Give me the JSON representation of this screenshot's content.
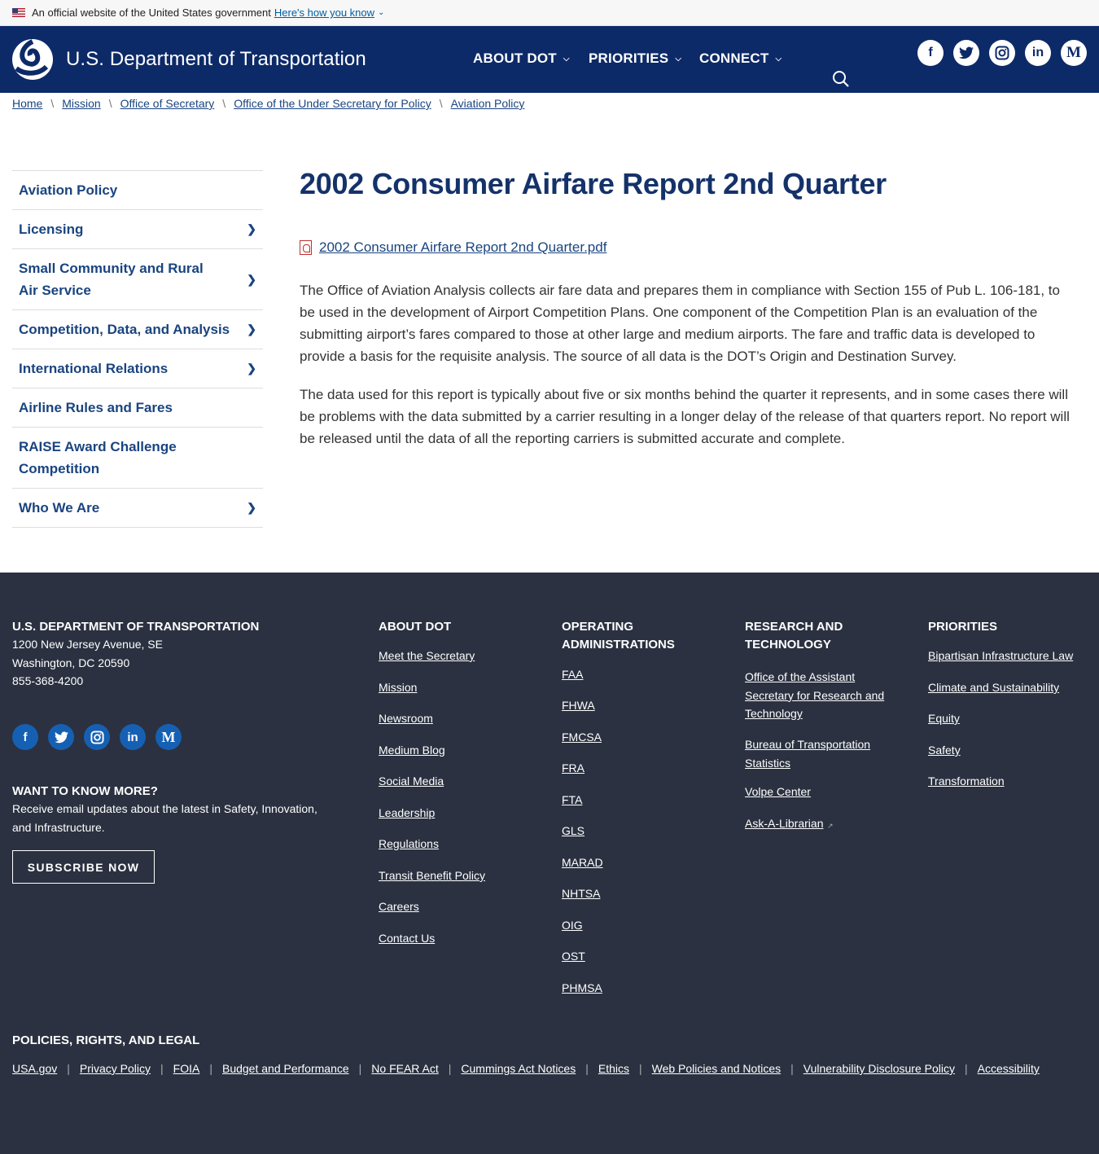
{
  "gov_banner": {
    "text": "An official website of the United States government",
    "link": "Here's how you know"
  },
  "header": {
    "brand": "U.S. Department of Transportation",
    "nav": [
      "ABOUT DOT",
      "PRIORITIES",
      "CONNECT"
    ],
    "social": [
      "facebook-icon",
      "twitter-icon",
      "instagram-icon",
      "linkedin-icon",
      "medium-icon"
    ]
  },
  "breadcrumb": [
    "Home",
    "Mission",
    "Office of Secretary",
    "Office of the Under Secretary for Policy",
    "Aviation Policy"
  ],
  "sidenav": [
    {
      "label": "Aviation Policy",
      "arrow": false
    },
    {
      "label": "Licensing",
      "arrow": true
    },
    {
      "label": "Small Community and Rural Air Service",
      "arrow": true
    },
    {
      "label": "Competition, Data, and Analysis",
      "arrow": true
    },
    {
      "label": "International Relations",
      "arrow": true
    },
    {
      "label": "Airline Rules and Fares",
      "arrow": false
    },
    {
      "label": "RAISE Award Challenge Competition",
      "arrow": false
    },
    {
      "label": "Who We Are",
      "arrow": true
    }
  ],
  "main": {
    "title": "2002 Consumer Airfare Report 2nd Quarter",
    "file": "2002 Consumer Airfare Report 2nd Quarter.pdf",
    "para1": "The Office of Aviation Analysis collects air fare data and prepares them in compliance with Section 155 of Pub L. 106-181, to be used in the development of Airport Competition Plans. One component of the Competition Plan is an evaluation of the submitting airport’s fares compared to those at other large and medium airports. The fare and traffic data is developed to provide a basis for the requisite analysis. The source of all data is the DOT’s Origin and Destination Survey.",
    "para2": "The data used for this report is typically about five or six months behind the quarter it represents, and in some cases there will be problems with the data submitted by a carrier resulting in a longer delay of the release of that quarters report.  No report will be released until the data of all the reporting carriers is submitted accurate and complete."
  },
  "footer": {
    "org": "U.S. DEPARTMENT OF TRANSPORTATION",
    "address1": "1200 New Jersey Avenue, SE",
    "address2": "Washington, DC 20590",
    "phone": "855-368-4200",
    "want_title": "WANT TO KNOW MORE?",
    "want_text": "Receive email updates about the latest in Safety, Innovation, and Infrastructure.",
    "subscribe": "SUBSCRIBE NOW",
    "about_title": "ABOUT DOT",
    "about": [
      "Meet the Secretary",
      "Mission",
      "Newsroom",
      "Medium Blog",
      "Social Media",
      "Leadership",
      "Regulations",
      "Transit Benefit Policy",
      "Careers",
      "Contact Us"
    ],
    "opadmin_title": "OPERATING ADMINISTRATIONS",
    "opadmin": [
      "FAA",
      "FHWA",
      "FMCSA",
      "FRA",
      "FTA",
      "GLS",
      "MARAD",
      "NHTSA",
      "OIG",
      "OST",
      "PHMSA"
    ],
    "research_title": "RESEARCH AND TECHNOLOGY",
    "research": [
      "Office of the Assistant Secretary for Research and Technology",
      "Bureau of Transportation Statistics",
      "Volpe Center",
      "Ask-A-Librarian"
    ],
    "priorities_title": "PRIORITIES",
    "priorities": [
      "Bipartisan Infrastructure Law",
      "Climate and Sustainability",
      "Equity",
      "Safety",
      "Transformation"
    ],
    "legal_title": "POLICIES, RIGHTS, AND LEGAL",
    "legal": [
      "USA.gov",
      "Privacy Policy",
      "FOIA",
      "Budget and Performance",
      "No FEAR Act",
      "Cummings Act Notices",
      "Ethics",
      "Web Policies and Notices",
      "Vulnerability Disclosure Policy",
      "Accessibility"
    ]
  }
}
